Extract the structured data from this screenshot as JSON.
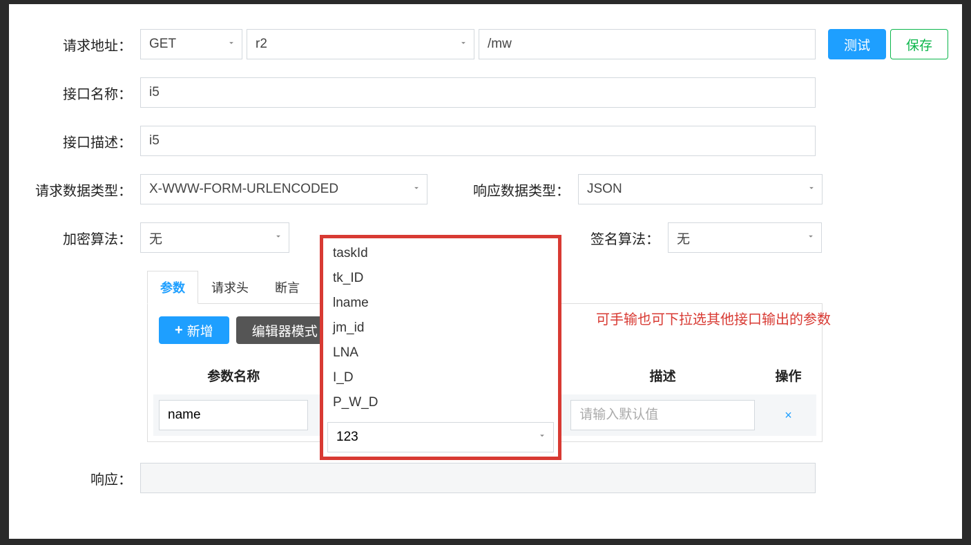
{
  "labels": {
    "request_address": "请求地址：",
    "interface_name": "接口名称：",
    "interface_desc": "接口描述：",
    "request_data_type": "请求数据类型：",
    "response_data_type": "响应数据类型：",
    "encrypt_algo": "加密算法：",
    "sign_algo": "签名算法：",
    "response": "响应："
  },
  "request": {
    "method": "GET",
    "host": "r2",
    "path": "/mw"
  },
  "buttons": {
    "test": "测试",
    "save": "保存",
    "add": "新增",
    "editor_mode": "编辑器模式"
  },
  "fields": {
    "interface_name": "i5",
    "interface_desc": "i5",
    "request_data_type": "X-WWW-FORM-URLENCODED",
    "response_data_type": "JSON",
    "encrypt_algo": "无",
    "sign_algo": "无"
  },
  "tabs": {
    "params": "参数",
    "headers": "请求头",
    "assertions": "断言"
  },
  "table": {
    "headers": {
      "param_name": "参数名称",
      "desc": "描述",
      "action": "操作"
    },
    "row": {
      "param_name": "name",
      "default_placeholder": "请输入默认值"
    }
  },
  "dropdown": {
    "options": [
      "taskId",
      "tk_ID",
      "lname",
      "jm_id",
      "LNA",
      "I_D",
      "P_W_D"
    ],
    "input_value": "123"
  },
  "annotation": "可手输也可下拉选其他接口输出的参数"
}
